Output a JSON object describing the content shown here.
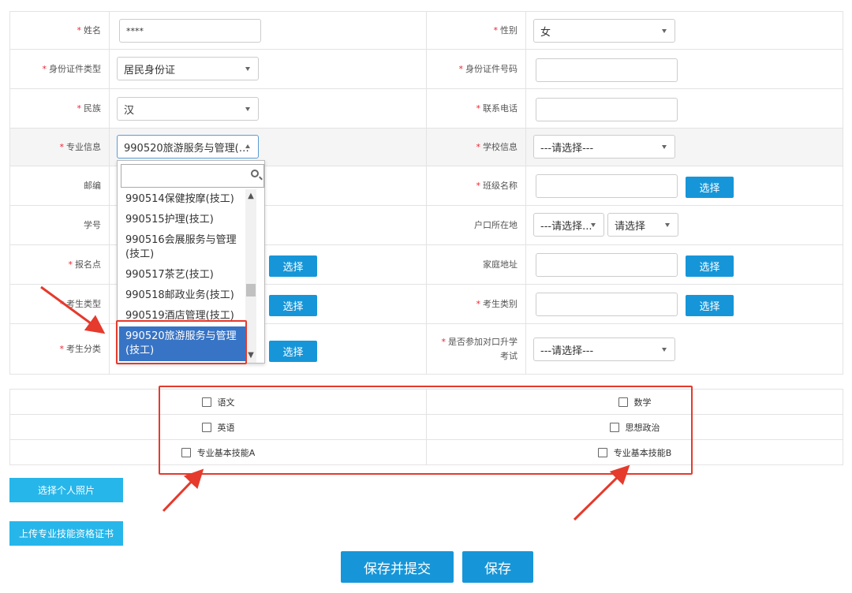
{
  "form": {
    "name": {
      "label": "姓名",
      "value": "****"
    },
    "gender": {
      "label": "性别",
      "value": "女"
    },
    "id_type": {
      "label": "身份证件类型",
      "value": "居民身份证"
    },
    "id_number": {
      "label": "身份证件号码",
      "value": ""
    },
    "ethnicity": {
      "label": "民族",
      "value": "汉"
    },
    "phone": {
      "label": "联系电话",
      "value": ""
    },
    "major": {
      "label": "专业信息",
      "value": "990520旅游服务与管理(…"
    },
    "school": {
      "label": "学校信息",
      "value": "---请选择---"
    },
    "postcode": {
      "label": "邮编"
    },
    "class_name": {
      "label": "班级名称",
      "value": "",
      "button": "选择"
    },
    "student_no": {
      "label": "学号"
    },
    "hukou": {
      "label": "户口所在地",
      "province": "---请选择...",
      "city": "请选择"
    },
    "enroll_site": {
      "label": "报名点",
      "button": "选择"
    },
    "home_address": {
      "label": "家庭地址",
      "value": "",
      "button": "选择"
    },
    "candidate_type": {
      "label": "考生类型",
      "button": "选择"
    },
    "candidate_category": {
      "label": "考生类别",
      "value": "",
      "button": "选择"
    },
    "candidate_class": {
      "label": "考生分类",
      "button": "选择"
    },
    "exam_join": {
      "label": "是否参加对口升学考试",
      "value": "---请选择---"
    }
  },
  "dropdown": {
    "items": [
      "990514保健按摩(技工)",
      "990515护理(技工)",
      "990516会展服务与管理(技工)",
      "990517茶艺(技工)",
      "990518邮政业务(技工)",
      "990519酒店管理(技工)",
      "990520旅游服务与管理(技工)"
    ],
    "selected_index": 6
  },
  "subjects": [
    [
      "语文",
      "数学"
    ],
    [
      "英语",
      "思想政治"
    ],
    [
      "专业基本技能A",
      "专业基本技能B"
    ]
  ],
  "buttons": {
    "photo": "选择个人照片",
    "certificate": "上传专业技能资格证书",
    "save_submit": "保存并提交",
    "save": "保存"
  },
  "colors": {
    "primary": "#1696d8",
    "accent": "#27b6ea",
    "highlight": "#e53a2c"
  }
}
